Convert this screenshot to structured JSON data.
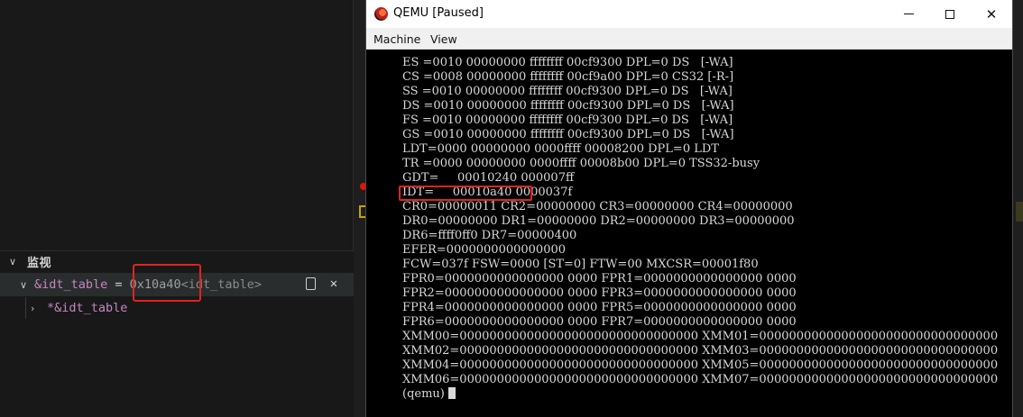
{
  "left_panel": {
    "watch": {
      "section_title": "监视",
      "expanded_icon": "chevron-down-icon",
      "items": [
        {
          "expression": "&idt_table",
          "equals": " = ",
          "value": "0x10a40",
          "symbol": "<idt_table>"
        },
        {
          "expression": "*&idt_table"
        }
      ],
      "actions": [
        "copy-value-icon",
        "remove-icon"
      ],
      "remove_glyph": "✕",
      "collapsed_glyph": "›",
      "expanded_glyph": "∨"
    }
  },
  "qemu": {
    "window_title": "QEMU [Paused]",
    "menu": [
      "Machine",
      "View"
    ],
    "window_buttons": [
      "minimize",
      "maximize",
      "close"
    ],
    "close_glyph": "✕",
    "console_lines": [
      "ES =0010 00000000 ffffffff 00cf9300 DPL=0 DS   [-WA]",
      "CS =0008 00000000 ffffffff 00cf9a00 DPL=0 CS32 [-R-]",
      "SS =0010 00000000 ffffffff 00cf9300 DPL=0 DS   [-WA]",
      "DS =0010 00000000 ffffffff 00cf9300 DPL=0 DS   [-WA]",
      "FS =0010 00000000 ffffffff 00cf9300 DPL=0 DS   [-WA]",
      "GS =0010 00000000 ffffffff 00cf9300 DPL=0 DS   [-WA]",
      "LDT=0000 00000000 0000ffff 00008200 DPL=0 LDT",
      "TR =0000 00000000 0000ffff 00008b00 DPL=0 TSS32-busy",
      "GDT=     00010240 000007ff",
      "IDT=     00010a40 0000037f",
      "CR0=00000011 CR2=00000000 CR3=00000000 CR4=00000000",
      "DR0=00000000 DR1=00000000 DR2=00000000 DR3=00000000",
      "DR6=ffff0ff0 DR7=00000400",
      "EFER=0000000000000000",
      "FCW=037f FSW=0000 [ST=0] FTW=00 MXCSR=00001f80",
      "FPR0=0000000000000000 0000 FPR1=0000000000000000 0000",
      "FPR2=0000000000000000 0000 FPR3=0000000000000000 0000",
      "FPR4=0000000000000000 0000 FPR5=0000000000000000 0000",
      "FPR6=0000000000000000 0000 FPR7=0000000000000000 0000",
      "XMM00=00000000000000000000000000000000 XMM01=00000000000000000000000000000000",
      "XMM02=00000000000000000000000000000000 XMM03=00000000000000000000000000000000",
      "XMM04=00000000000000000000000000000000 XMM05=00000000000000000000000000000000",
      "XMM06=00000000000000000000000000000000 XMM07=00000000000000000000000000000000"
    ],
    "prompt": "(qemu)"
  },
  "colors": {
    "highlight_box": "#e0241d",
    "watch_expression": "#c586c0",
    "breakpoint": "#e51400"
  }
}
